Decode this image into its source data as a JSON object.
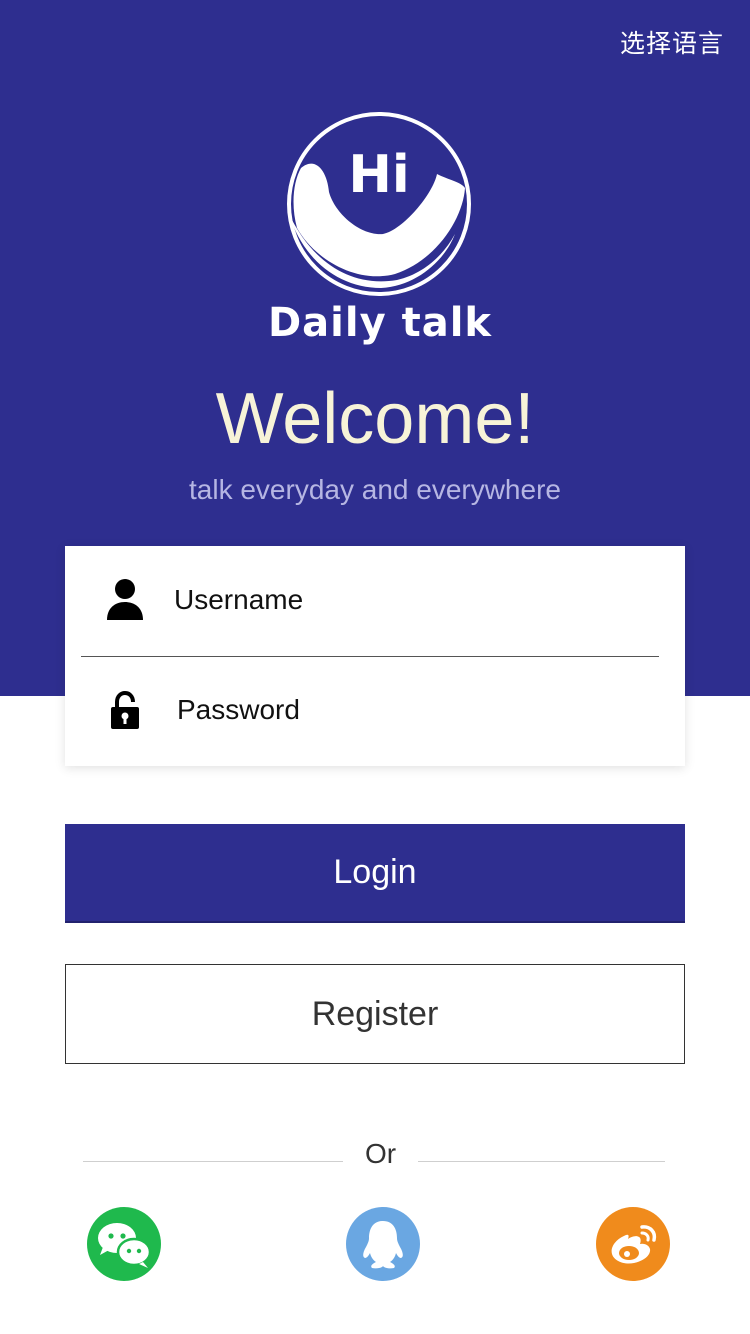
{
  "header": {
    "language_label": "选择语言"
  },
  "brand": {
    "logo_text": "Hi",
    "name": "Daily talk"
  },
  "hero": {
    "title": "Welcome!",
    "tagline": "talk everyday and everywhere"
  },
  "form": {
    "username_placeholder": "Username",
    "password_placeholder": "Password",
    "username_icon": "user-icon",
    "password_icon": "lock-icon"
  },
  "actions": {
    "login_label": "Login",
    "register_label": "Register",
    "or_label": "Or"
  },
  "social": [
    {
      "name": "wechat",
      "icon": "wechat-icon",
      "color": "#1fb94d"
    },
    {
      "name": "qq",
      "icon": "qq-icon",
      "color": "#6aa7e2"
    },
    {
      "name": "weibo",
      "icon": "weibo-icon",
      "color": "#f08b1c"
    }
  ],
  "colors": {
    "primary": "#2e2e8f",
    "welcome_text": "#f7f3d8",
    "tagline_text": "#b6b6e3"
  }
}
